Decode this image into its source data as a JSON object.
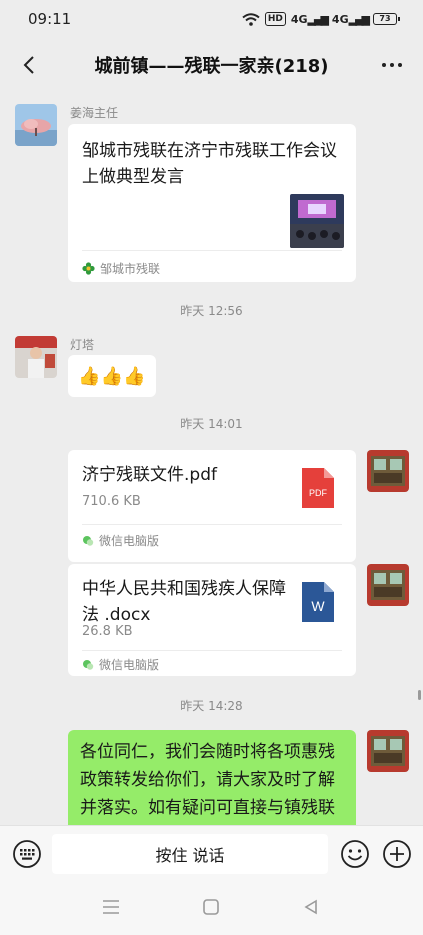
{
  "status": {
    "time": "09:11",
    "hd": "HD",
    "sig1": "4G",
    "sig2": "4G",
    "battery": "73"
  },
  "header": {
    "title": "城前镇——残联一家亲(218)"
  },
  "messages": {
    "m1": {
      "sender": "姜海主任",
      "link_title": "邹城市残联在济宁市残联工作会议上做典型发言",
      "source": "邹城市残联"
    },
    "t1": "昨天 12:56",
    "m2": {
      "sender": "灯塔",
      "emoji": "👍👍👍"
    },
    "t2": "昨天 14:01",
    "m3": {
      "file_name": "济宁残联文件.pdf",
      "file_size": "710.6 KB",
      "file_type": "PDF",
      "source": "微信电脑版"
    },
    "m4": {
      "file_name": "中华人民共和国残疾人保障法 .docx",
      "file_size": "26.8 KB",
      "file_type": "W",
      "source": "微信电脑版"
    },
    "t3": "昨天 14:28",
    "m5": {
      "text": "各位同仁，我们会随时将各项惠残政策转发给你们，请大家及时了解并落实。如有疑问可直接与镇残联联系，我们随时为您服务！"
    }
  },
  "input": {
    "hold_to_talk": "按住 说话"
  },
  "colors": {
    "green_bubble": "#95ec69",
    "pdf": "#e5403b",
    "word": "#2b5797"
  }
}
